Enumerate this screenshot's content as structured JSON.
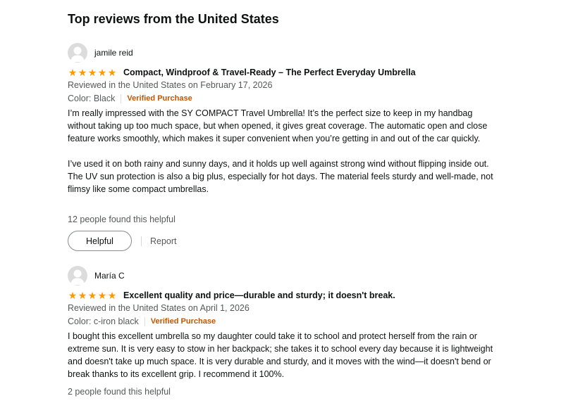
{
  "section": {
    "title": "Top reviews from the United States"
  },
  "reviews": [
    {
      "author": "jamile reid",
      "rating": 5,
      "title": "Compact, Windproof & Travel-Ready – The Perfect Everyday Umbrella",
      "date": "Reviewed in the United States on February 17, 2026",
      "format": "Color: Black",
      "verified": "Verified Purchase",
      "body": [
        "I’m really impressed with the SY COMPACT Travel Umbrella! It’s the perfect size to keep in my handbag without taking up too much space, but when opened, it gives great coverage. The automatic open and close feature works smoothly, which makes it super convenient when you’re getting in and out of the car quickly.",
        "I’ve used it on both rainy and sunny days, and it holds up well against strong wind without flipping inside out. The UV sun protection is also a big plus, especially for hot days. The material feels sturdy and well-made, not flimsy like some compact umbrellas."
      ],
      "helpful_count": "12 people found this helpful",
      "helpful_label": "Helpful",
      "report_label": "Report"
    },
    {
      "author": "María C",
      "rating": 5,
      "title": "Excellent quality and price—durable and sturdy; it doesn't break.",
      "date": "Reviewed in the United States on April 1, 2026",
      "format": "Color: c-iron black",
      "verified": "Verified Purchase",
      "body": [
        "I bought this excellent umbrella so my daughter could take it to school and protect herself from the rain or extreme sun. It is very easy to stow in her backpack; she takes it to school every day because it is lightweight and doesn't take up much space. It is very durable and sturdy, and it moves with the wind—it doesn't bend or break thanks to its excellent grip. I recommend it 100%."
      ],
      "helpful_count": "2 people found this helpful"
    }
  ],
  "icons": {
    "avatar": "user-avatar-icon",
    "star": "star-icon"
  },
  "colors": {
    "star": "#ff9900",
    "verified": "#c45500",
    "meta": "#565959"
  }
}
